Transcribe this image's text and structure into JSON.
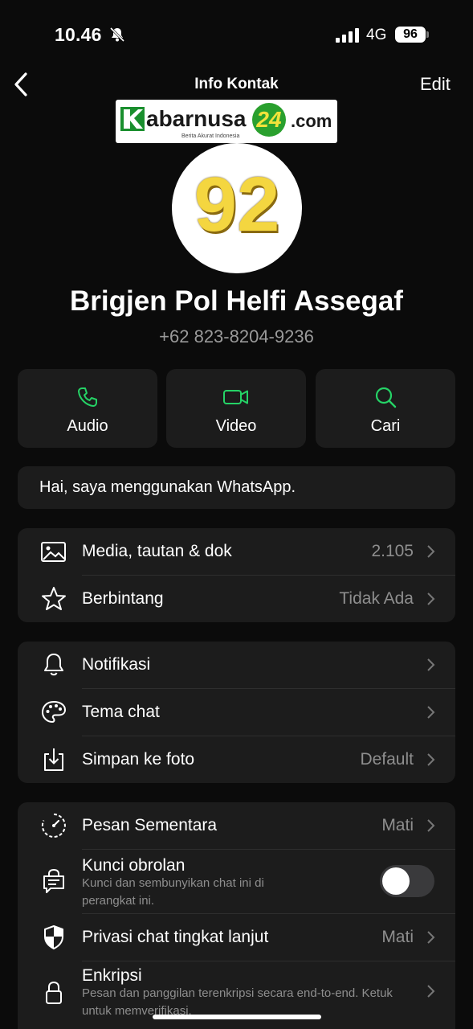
{
  "status": {
    "time": "10.46",
    "network": "4G",
    "battery": "96"
  },
  "nav": {
    "title": "Info Kontak",
    "edit": "Edit"
  },
  "logo": {
    "brand": "abarnusa",
    "number": "24",
    "domain": ".com",
    "tagline": "Berita Akurat Indonesia"
  },
  "avatar": {
    "text": "92"
  },
  "contact": {
    "name": "Brigjen Pol Helfi Assegaf",
    "phone": "+62 823-8204-9236"
  },
  "actions": [
    {
      "label": "Audio",
      "icon": "phone-icon"
    },
    {
      "label": "Video",
      "icon": "video-icon"
    },
    {
      "label": "Cari",
      "icon": "search-icon"
    }
  ],
  "about": "Hai, saya menggunakan WhatsApp.",
  "section1": [
    {
      "label": "Media, tautan & dok",
      "value": "2.105",
      "icon": "image-icon"
    },
    {
      "label": "Berbintang",
      "value": "Tidak Ada",
      "icon": "star-icon"
    }
  ],
  "section2": [
    {
      "label": "Notifikasi",
      "value": "",
      "icon": "bell-icon"
    },
    {
      "label": "Tema chat",
      "value": "",
      "icon": "palette-icon"
    },
    {
      "label": "Simpan ke foto",
      "value": "Default",
      "icon": "download-icon"
    }
  ],
  "section3": {
    "disappearing": {
      "label": "Pesan Sementara",
      "value": "Mati"
    },
    "lock": {
      "label": "Kunci obrolan",
      "sub": "Kunci dan sembunyikan chat ini di perangkat ini.",
      "toggle_on": false
    },
    "privacy": {
      "label": "Privasi chat tingkat lanjut",
      "value": "Mati"
    },
    "encryption": {
      "label": "Enkripsi",
      "sub": "Pesan dan panggilan terenkripsi secara end-to-end. Ketuk untuk memverifikasi."
    }
  },
  "colors": {
    "accent": "#25d366",
    "card": "#1c1c1c",
    "background": "#0b0b0b",
    "muted": "#8e8e8e"
  }
}
